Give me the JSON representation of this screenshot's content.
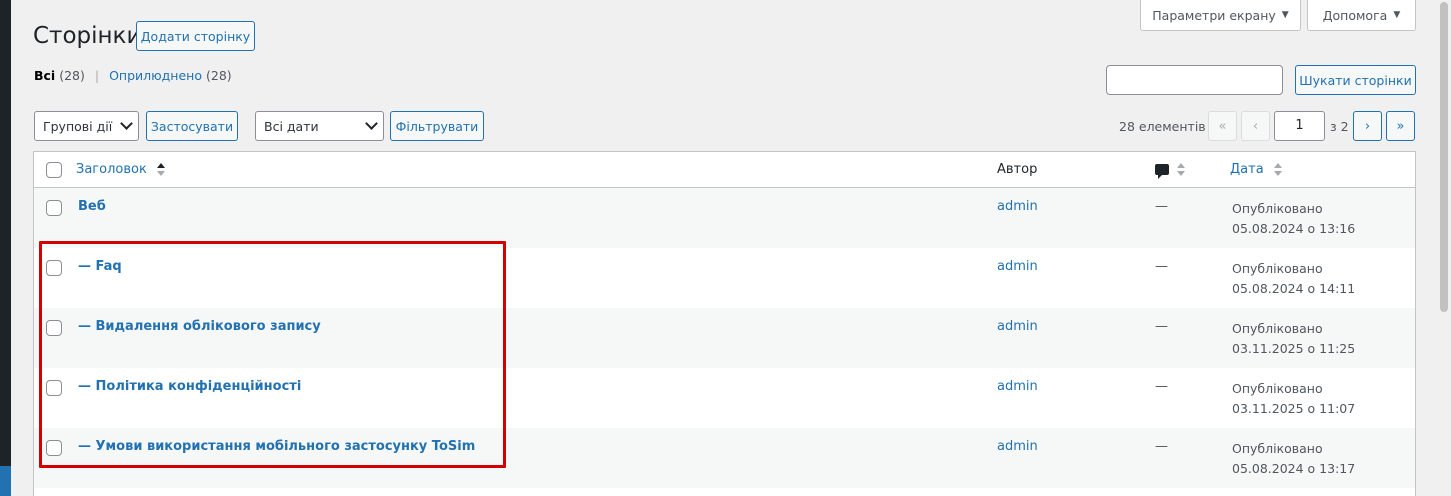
{
  "page": {
    "title": "Сторінки",
    "add_button": "Додати сторінку"
  },
  "screen_options": {
    "label": "Параметри екрану"
  },
  "help": {
    "label": "Допомога"
  },
  "filters_views": {
    "all_label": "Всі",
    "all_count": "(28)",
    "separator": "|",
    "published_label": "Оприлюднено",
    "published_count": "(28)"
  },
  "search": {
    "value": "",
    "button": "Шукати сторінки"
  },
  "bulk": {
    "selected": "Групові дії",
    "apply": "Застосувати"
  },
  "dates": {
    "selected": "Всі дати",
    "filter": "Фільтрувати"
  },
  "pagination": {
    "items": "28 елементів",
    "first": "«",
    "prev": "‹",
    "current_page": "1",
    "of_total": "з 2",
    "next": "›",
    "last": "»"
  },
  "table": {
    "columns": {
      "title": "Заголовок",
      "author": "Автор",
      "date": "Дата"
    },
    "rows": [
      {
        "title": "Веб",
        "author": "admin",
        "comments": "—",
        "status": "Опубліковано",
        "date": "05.08.2024 о 13:16"
      },
      {
        "title": "— Faq",
        "author": "admin",
        "comments": "—",
        "status": "Опубліковано",
        "date": "05.08.2024 о 14:11"
      },
      {
        "title": "— Видалення облікового запису",
        "author": "admin",
        "comments": "—",
        "status": "Опубліковано",
        "date": "03.11.2025 о 11:25"
      },
      {
        "title": "— Політика конфіденційності",
        "author": "admin",
        "comments": "—",
        "status": "Опубліковано",
        "date": "03.11.2025 о 11:07"
      },
      {
        "title": "— Умови використання мобільного застосунку ToSim",
        "author": "admin",
        "comments": "—",
        "status": "Опубліковано",
        "date": "05.08.2024 о 13:17"
      }
    ]
  },
  "colors": {
    "link": "#2271b1",
    "highlight": "#d40000",
    "background": "#f0f0f1"
  }
}
